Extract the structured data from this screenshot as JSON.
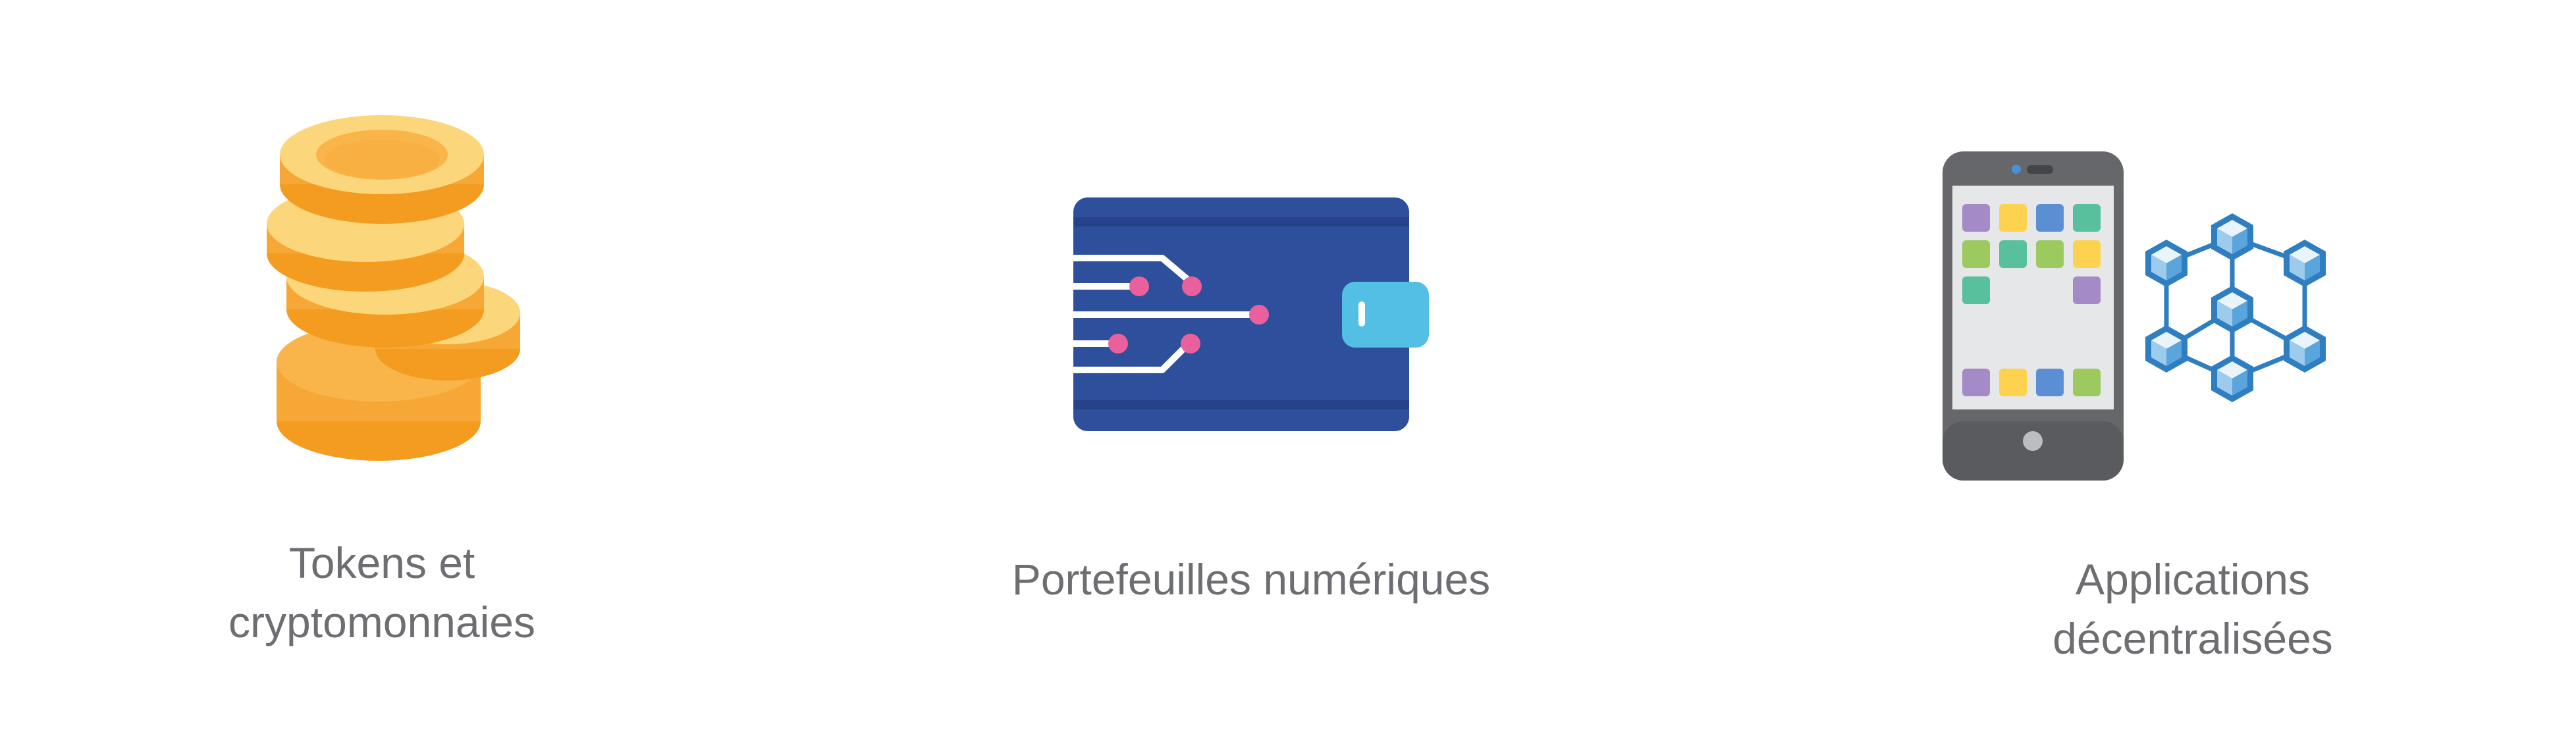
{
  "items": [
    {
      "icon": "coins-stack-icon",
      "caption_lines": [
        "Tokens et",
        "cryptomonnaies"
      ]
    },
    {
      "icon": "digital-wallet-icon",
      "caption_lines": [
        "Portefeuilles numériques"
      ]
    },
    {
      "icon": "smartphone-blockchain-icon",
      "caption_lines": [
        "Applications",
        "décentralisées"
      ]
    }
  ],
  "colors": {
    "text": "#6d6e71",
    "coin_gold": "#f7a735",
    "coin_light": "#fbd67a",
    "wallet_blue": "#2e4f9b",
    "wallet_clasp": "#54bfe5",
    "circuit_pink": "#e9609c",
    "phone_gray": "#66676b",
    "screen_bg": "#e6e7e8",
    "network_blue": "#2f7ec2"
  }
}
